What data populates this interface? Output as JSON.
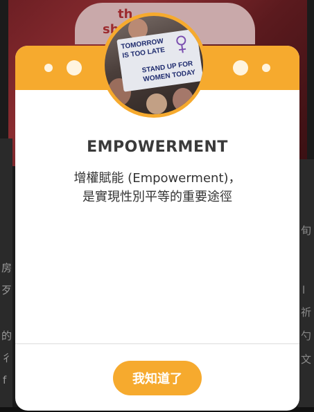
{
  "background": {
    "sign_text_1": "th",
    "sign_text_2": "sh",
    "left_glyphs": [
      "房",
      "歹",
      "的",
      "彳",
      "f"
    ],
    "right_glyphs": [
      "旬",
      "l",
      "祈",
      "勺",
      "文"
    ]
  },
  "dialog": {
    "title": "EMPOWERMENT",
    "body_line_1": "增權賦能 (Empowerment)，",
    "body_line_2": "是實現性別平等的重要途徑",
    "ok_label": "我知道了",
    "placard": {
      "lines": [
        "TOMORROW",
        "IS TOO LATE",
        "STAND UP FOR",
        "WOMEN TODAY"
      ]
    }
  },
  "colors": {
    "accent": "#f6aa2e",
    "title_text": "#3a3a3a",
    "placard_ink": "#1e2b6e",
    "placard_symbol": "#7b4fb0"
  }
}
